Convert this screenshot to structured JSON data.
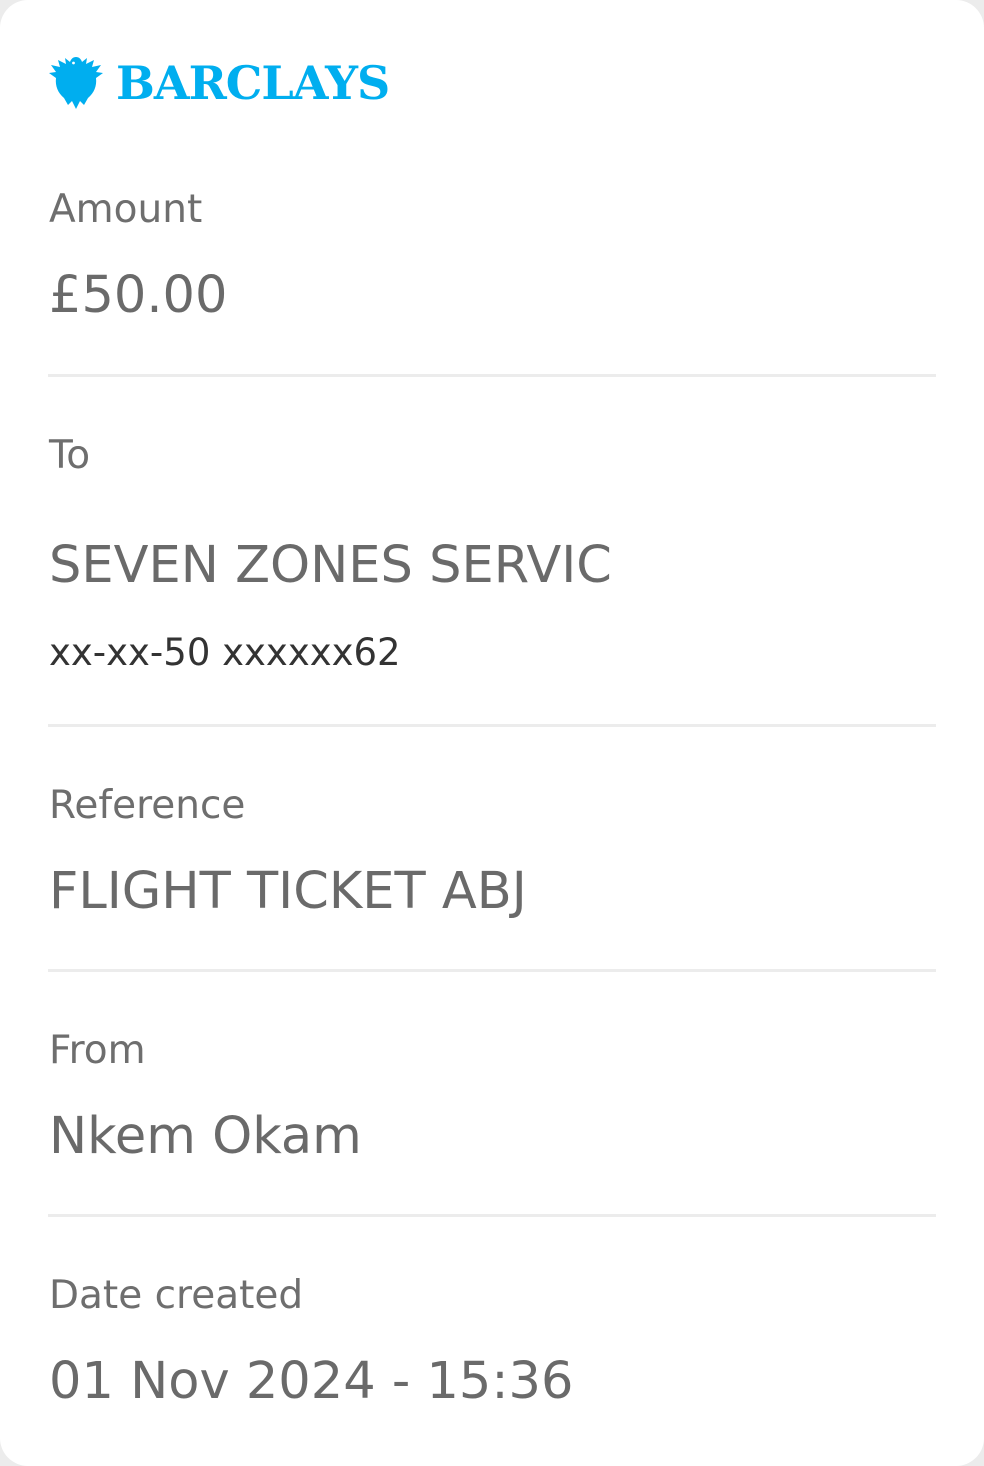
{
  "brand": {
    "name": "BARCLAYS",
    "color": "#00aeef",
    "icon": "eagle-icon"
  },
  "amount": {
    "label": "Amount",
    "value": "£50.00"
  },
  "to": {
    "label": "To",
    "name": "SEVEN ZONES SERVIC",
    "account": "xx-xx-50 xxxxxx62"
  },
  "reference": {
    "label": "Reference",
    "value": "FLIGHT TICKET ABJ"
  },
  "from": {
    "label": "From",
    "value": "Nkem Okam"
  },
  "date_created": {
    "label": "Date created",
    "value": "01 Nov 2024 - 15:36"
  }
}
